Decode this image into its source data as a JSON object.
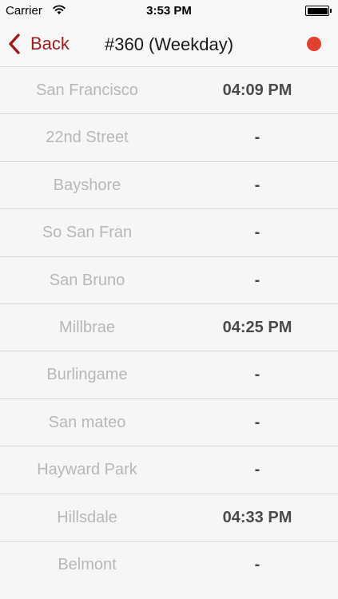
{
  "status_bar": {
    "carrier": "Carrier",
    "time": "3:53 PM",
    "battery_level": 1.0
  },
  "nav_bar": {
    "back_label": "Back",
    "title": "#360 (Weekday)",
    "record_color": "#e0402d",
    "accent_color": "#9b1c1c"
  },
  "schedule": [
    {
      "stop": "San Francisco",
      "time": "04:09 PM"
    },
    {
      "stop": "22nd Street",
      "time": "-"
    },
    {
      "stop": "Bayshore",
      "time": "-"
    },
    {
      "stop": "So San Fran",
      "time": "-"
    },
    {
      "stop": "San Bruno",
      "time": "-"
    },
    {
      "stop": "Millbrae",
      "time": "04:25 PM"
    },
    {
      "stop": "Burlingame",
      "time": "-"
    },
    {
      "stop": "San mateo",
      "time": "-"
    },
    {
      "stop": "Hayward Park",
      "time": "-"
    },
    {
      "stop": "Hillsdale",
      "time": "04:33 PM"
    },
    {
      "stop": "Belmont",
      "time": "-"
    }
  ]
}
